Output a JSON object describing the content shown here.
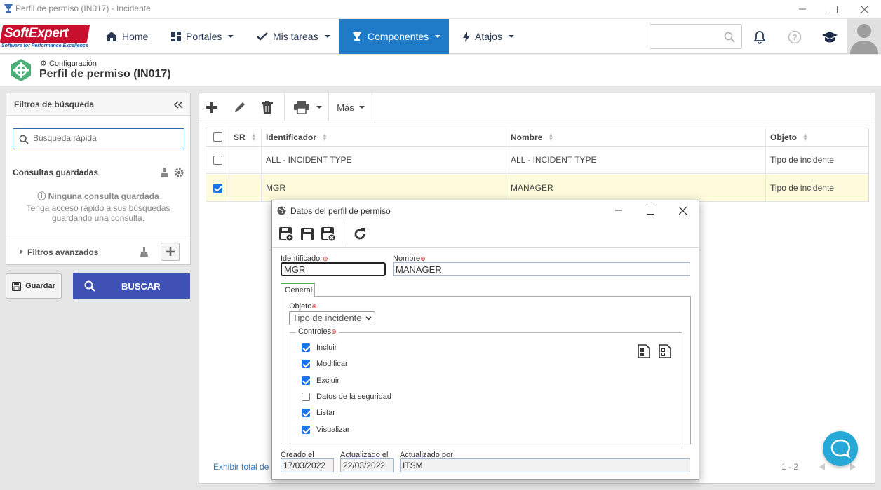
{
  "window": {
    "title": "Perfil de permiso (IN017) - Incidente"
  },
  "brand": {
    "name": "SoftExpert",
    "tagline": "Software for Performance Excellence",
    "color": "#c8102e"
  },
  "nav": {
    "home": "Home",
    "portales": "Portales",
    "tareas": "Mis tareas",
    "componentes": "Componentes",
    "atajos": "Atajos",
    "active_color": "#1f7bc8"
  },
  "header": {
    "breadcrumb": "Configuración",
    "title": "Perfil de permiso (IN017)"
  },
  "filters": {
    "title": "Filtros de búsqueda",
    "quick_search_placeholder": "Búsqueda rápida",
    "saved_queries": "Consultas guardadas",
    "no_query": "Ninguna consulta guardada",
    "no_query_help": "Tenga acceso rápido a sus búsquedas guardando una consulta.",
    "advanced": "Filtros avanzados",
    "save_label": "Guardar",
    "search_label": "BUSCAR"
  },
  "toolbar": {
    "more": "Más"
  },
  "grid": {
    "columns": [
      "SR",
      "Identificador",
      "Nombre",
      "Objeto"
    ],
    "rows": [
      {
        "checked": false,
        "sr": "",
        "id": "ALL - INCIDENT TYPE",
        "name": "ALL - INCIDENT TYPE",
        "object": "Tipo de incidente"
      },
      {
        "checked": true,
        "sr": "",
        "id": "MGR",
        "name": "MANAGER",
        "object": "Tipo de incidente"
      }
    ],
    "footer_link": "Exhibir total de",
    "pager": "1 - 2"
  },
  "dialog": {
    "title": "Datos del perfil de permiso",
    "id_label": "Identificador",
    "id_value": "MGR",
    "name_label": "Nombre",
    "name_value": "MANAGER",
    "tab": "General",
    "object_label": "Objeto",
    "object_value": "Tipo de incidente",
    "controls_label": "Controles",
    "controls": [
      {
        "label": "Incluir",
        "checked": true
      },
      {
        "label": "Modificar",
        "checked": true
      },
      {
        "label": "Excluir",
        "checked": true
      },
      {
        "label": "Datos de la seguridad",
        "checked": false
      },
      {
        "label": "Listar",
        "checked": true
      },
      {
        "label": "Visualizar",
        "checked": true
      }
    ],
    "created_label": "Creado el",
    "created_value": "17/03/2022",
    "updated_label": "Actualizado el",
    "updated_value": "22/03/2022",
    "updated_by_label": "Actualizado por",
    "updated_by_value": "ITSM"
  }
}
